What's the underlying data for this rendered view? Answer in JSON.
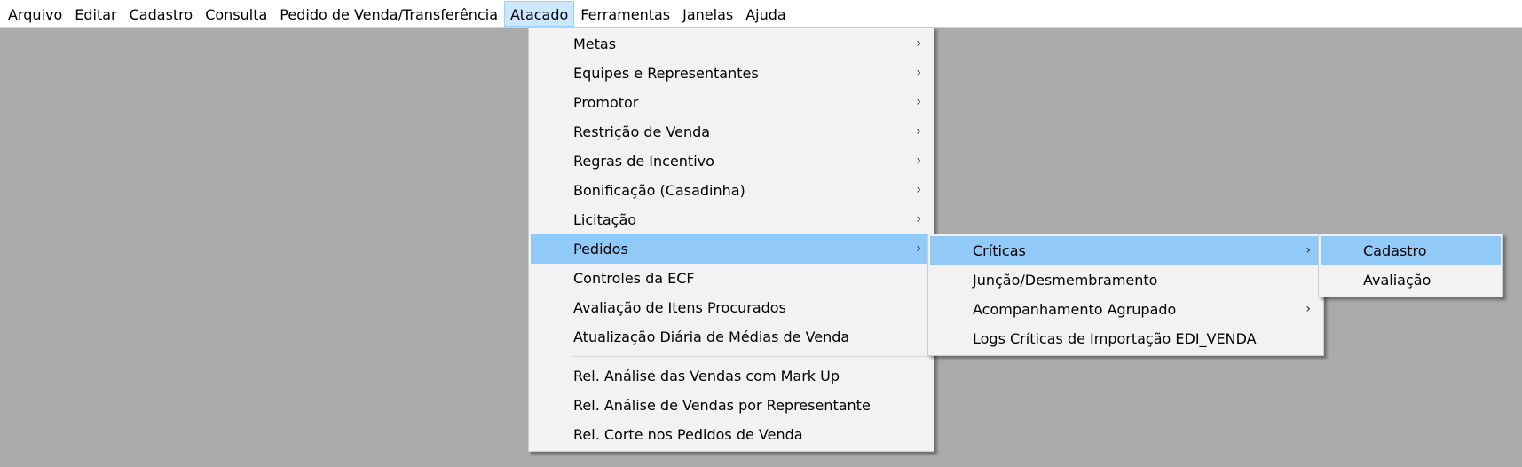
{
  "menubar": {
    "items": [
      "Arquivo",
      "Editar",
      "Cadastro",
      "Consulta",
      "Pedido de Venda/Transferência",
      "Atacado",
      "Ferramentas",
      "Janelas",
      "Ajuda"
    ],
    "active_index": 5
  },
  "atacado_menu": {
    "items": [
      {
        "label": "Metas",
        "submenu": true
      },
      {
        "label": "Equipes e Representantes",
        "submenu": true
      },
      {
        "label": "Promotor",
        "submenu": true
      },
      {
        "label": "Restrição de Venda",
        "submenu": true
      },
      {
        "label": "Regras de Incentivo",
        "submenu": true
      },
      {
        "label": "Bonificação (Casadinha)",
        "submenu": true
      },
      {
        "label": "Licitação",
        "submenu": true
      },
      {
        "label": "Pedidos",
        "submenu": true,
        "highlighted": true
      },
      {
        "label": "Controles da ECF",
        "submenu": false
      },
      {
        "label": "Avaliação de Itens Procurados",
        "submenu": false
      },
      {
        "label": "Atualização Diária de Médias de Venda",
        "submenu": false
      }
    ],
    "report_items": [
      {
        "label": "Rel. Análise das Vendas com Mark Up",
        "submenu": false
      },
      {
        "label": "Rel. Análise de Vendas por Representante",
        "submenu": false
      },
      {
        "label": "Rel. Corte nos Pedidos de Venda",
        "submenu": false
      }
    ]
  },
  "pedidos_menu": {
    "items": [
      {
        "label": "Críticas",
        "submenu": true,
        "highlighted": true
      },
      {
        "label": "Junção/Desmembramento",
        "submenu": false
      },
      {
        "label": "Acompanhamento Agrupado",
        "submenu": true
      },
      {
        "label": "Logs Críticas de Importação EDI_VENDA",
        "submenu": false
      }
    ]
  },
  "criticas_menu": {
    "items": [
      {
        "label": "Cadastro",
        "submenu": false,
        "highlighted": true
      },
      {
        "label": "Avaliação",
        "submenu": false
      }
    ]
  },
  "icons": {
    "submenu_arrow": "chevron-right-icon"
  },
  "colors": {
    "highlight": "#91c9f7",
    "menubar_active": "#cce8ff",
    "background": "#ababab"
  }
}
